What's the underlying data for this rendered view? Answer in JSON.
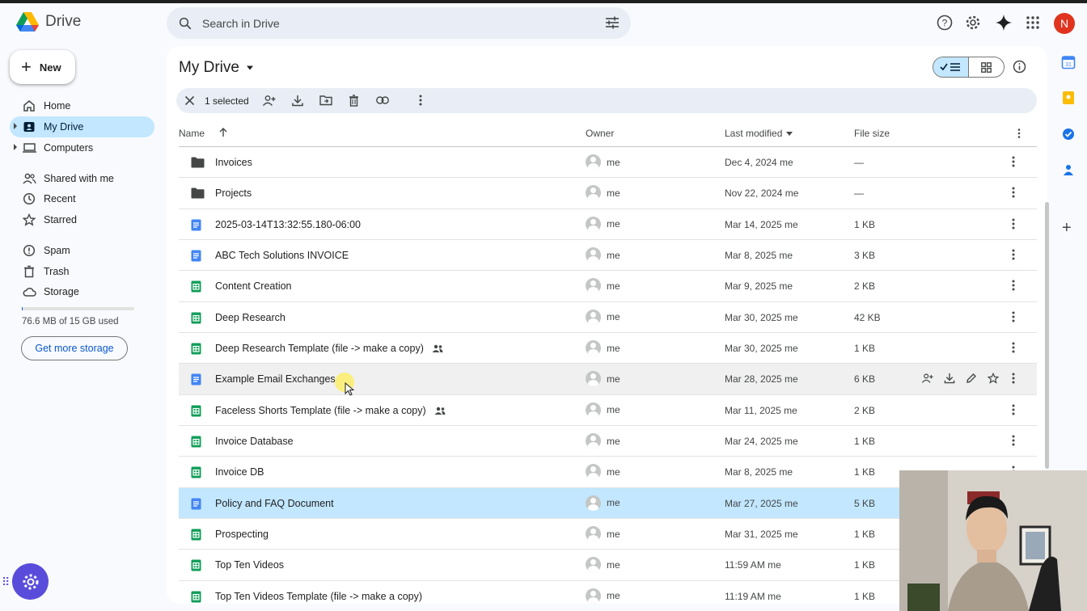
{
  "app": {
    "name": "Drive",
    "avatar_letter": "N"
  },
  "search": {
    "placeholder": "Search in Drive"
  },
  "sidebar": {
    "new_label": "New",
    "items": [
      {
        "label": "Home",
        "icon": "home-icon"
      },
      {
        "label": "My Drive",
        "icon": "my-drive-icon",
        "active": true
      },
      {
        "label": "Computers",
        "icon": "computers-icon"
      },
      {
        "label": "Shared with me",
        "icon": "shared-icon"
      },
      {
        "label": "Recent",
        "icon": "clock-icon"
      },
      {
        "label": "Starred",
        "icon": "star-icon"
      },
      {
        "label": "Spam",
        "icon": "spam-icon"
      },
      {
        "label": "Trash",
        "icon": "trash-icon"
      },
      {
        "label": "Storage",
        "icon": "cloud-icon"
      }
    ],
    "storage_used": "76.6 MB of 15 GB used",
    "storage_fraction": 0.005,
    "get_storage_label": "Get more storage"
  },
  "main": {
    "title": "My Drive",
    "selection_text": "1 selected",
    "columns": {
      "name": "Name",
      "owner": "Owner",
      "modified": "Last modified",
      "size": "File size"
    },
    "files": [
      {
        "name": "Invoices",
        "type": "folder",
        "owner": "me",
        "modified": "Dec 4, 2024 me",
        "size": "—"
      },
      {
        "name": "Projects",
        "type": "folder",
        "owner": "me",
        "modified": "Nov 22, 2024 me",
        "size": "—"
      },
      {
        "name": "2025-03-14T13:32:55.180-06:00",
        "type": "doc",
        "owner": "me",
        "modified": "Mar 14, 2025 me",
        "size": "1 KB"
      },
      {
        "name": "ABC Tech Solutions INVOICE",
        "type": "doc",
        "owner": "me",
        "modified": "Mar 8, 2025 me",
        "size": "3 KB"
      },
      {
        "name": "Content Creation",
        "type": "sheet",
        "owner": "me",
        "modified": "Mar 9, 2025 me",
        "size": "2 KB"
      },
      {
        "name": "Deep Research",
        "type": "sheet",
        "owner": "me",
        "modified": "Mar 30, 2025 me",
        "size": "42 KB"
      },
      {
        "name": "Deep Research Template (file -> make a copy)",
        "type": "sheet",
        "shared": true,
        "owner": "me",
        "modified": "Mar 30, 2025 me",
        "size": "1 KB"
      },
      {
        "name": "Example Email Exchanges",
        "type": "doc",
        "owner": "me",
        "modified": "Mar 28, 2025 me",
        "size": "6 KB",
        "hover": true
      },
      {
        "name": "Faceless Shorts Template (file -> make a copy)",
        "type": "sheet",
        "shared": true,
        "owner": "me",
        "modified": "Mar 11, 2025 me",
        "size": "2 KB"
      },
      {
        "name": "Invoice Database",
        "type": "sheet",
        "owner": "me",
        "modified": "Mar 24, 2025 me",
        "size": "1 KB"
      },
      {
        "name": "Invoice DB",
        "type": "sheet",
        "owner": "me",
        "modified": "Mar 8, 2025 me",
        "size": "1 KB"
      },
      {
        "name": "Policy and FAQ Document",
        "type": "doc",
        "owner": "me",
        "modified": "Mar 27, 2025 me",
        "size": "5 KB",
        "selected": true
      },
      {
        "name": "Prospecting",
        "type": "sheet",
        "owner": "me",
        "modified": "Mar 31, 2025 me",
        "size": "1 KB"
      },
      {
        "name": "Top Ten Videos",
        "type": "sheet",
        "owner": "me",
        "modified": "11:59 AM me",
        "size": "1 KB"
      },
      {
        "name": "Top Ten Videos Template (file -> make a copy)",
        "type": "sheet",
        "owner": "me",
        "modified": "11:19 AM me",
        "size": "1 KB"
      }
    ]
  },
  "colors": {
    "selected_row": "#c2e7ff",
    "accent": "#0b57d0",
    "doc_blue": "#4285f4",
    "sheet_green": "#0f9d58"
  }
}
